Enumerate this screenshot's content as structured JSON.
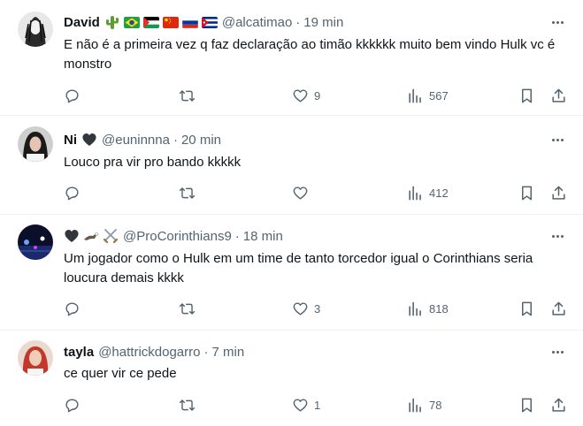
{
  "tweets": [
    {
      "name": "David",
      "name_emojis": [
        "cactus-emoji",
        "brazil-flag",
        "palestine-flag",
        "china-flag",
        "russia-flag",
        "cuba-flag"
      ],
      "handle": "@alcatimao",
      "dot": "·",
      "time": "19 min",
      "text": "E não é a primeira vez q faz declaração ao timão kkkkkk muito bem vindo Hulk vc é monstro",
      "likes": "9",
      "views": "567"
    },
    {
      "name": "Ni",
      "name_emojis": [
        "black-heart-emoji"
      ],
      "handle": "@euninnna",
      "dot": "·",
      "time": "20 min",
      "text": "Louco pra vir pro bando kkkkk",
      "likes": "",
      "views": "412"
    },
    {
      "name": "",
      "name_emojis": [
        "black-heart-emoji",
        "eagle-emoji",
        "crossed-swords-emoji"
      ],
      "handle": "@ProCorinthians9",
      "dot": "·",
      "time": "18 min",
      "text": "Um jogador como o Hulk em um time de tanto torcedor igual o Corinthians seria loucura demais kkkk",
      "likes": "3",
      "views": "818"
    },
    {
      "name": "tayla",
      "name_emojis": [],
      "handle": "@hattrickdogarro",
      "dot": "·",
      "time": "7 min",
      "text": "ce quer vir ce pede",
      "likes": "1",
      "views": "78"
    }
  ],
  "colors": {
    "text": "#0f1419",
    "secondary": "#536471",
    "divider": "#eff3f4"
  }
}
